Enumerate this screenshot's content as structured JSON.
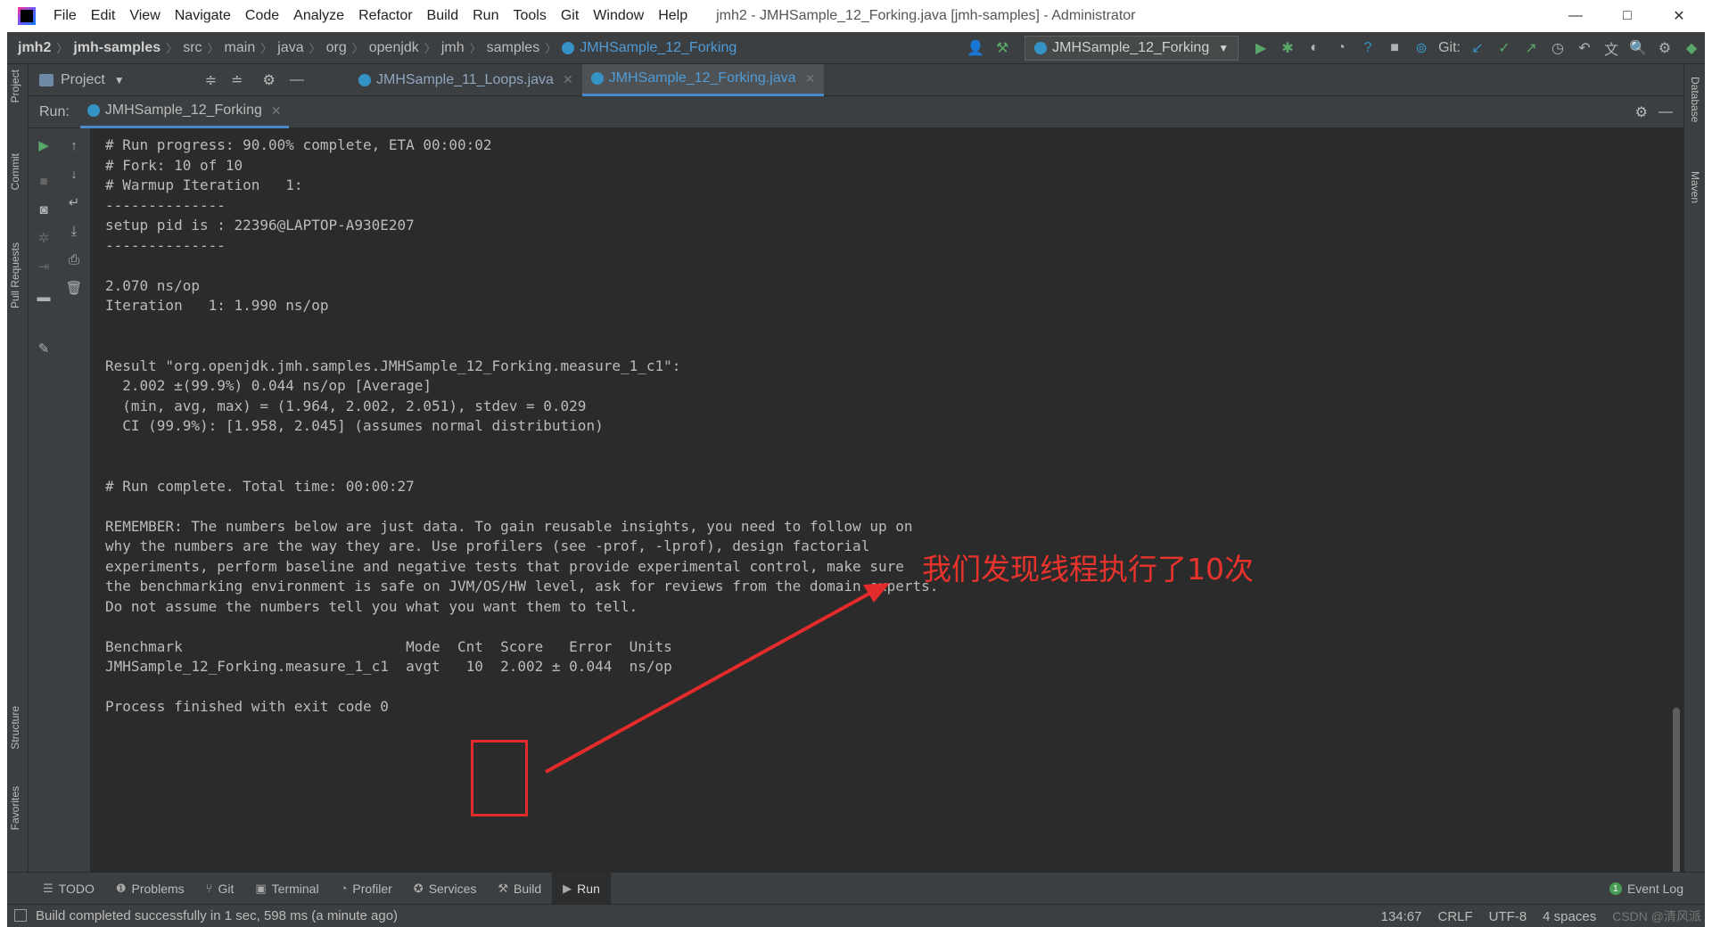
{
  "window": {
    "title": "jmh2 - JMHSample_12_Forking.java [jmh-samples] - Administrator",
    "controls": [
      "—",
      "□",
      "✕"
    ]
  },
  "menu": [
    "File",
    "Edit",
    "View",
    "Navigate",
    "Code",
    "Analyze",
    "Refactor",
    "Build",
    "Run",
    "Tools",
    "Git",
    "Window",
    "Help"
  ],
  "breadcrumbs": [
    "jmh2",
    "jmh-samples",
    "src",
    "main",
    "java",
    "org",
    "openjdk",
    "jmh",
    "samples",
    "JMHSample_12_Forking"
  ],
  "toolbar": {
    "run_config": "JMHSample_12_Forking",
    "git_label": "Git:"
  },
  "editor_tabs": {
    "project_label": "Project",
    "files": [
      "JMHSample_11_Loops.java",
      "JMHSample_12_Forking.java"
    ]
  },
  "side_tabs": {
    "left": [
      "Project",
      "Commit",
      "Pull Requests",
      "Structure",
      "Favorites"
    ],
    "right": [
      "Database",
      "Maven"
    ]
  },
  "run_panel": {
    "label": "Run:",
    "tab": "JMHSample_12_Forking"
  },
  "console": {
    "lines": [
      "# Run progress: 90.00% complete, ETA 00:00:02",
      "# Fork: 10 of 10",
      "# Warmup Iteration   1:",
      "--------------",
      "setup pid is : 22396@LAPTOP-A930E207",
      "--------------",
      "",
      "2.070 ns/op",
      "Iteration   1: 1.990 ns/op",
      "",
      "",
      "Result \"org.openjdk.jmh.samples.JMHSample_12_Forking.measure_1_c1\":",
      "  2.002 ±(99.9%) 0.044 ns/op [Average]",
      "  (min, avg, max) = (1.964, 2.002, 2.051), stdev = 0.029",
      "  CI (99.9%): [1.958, 2.045] (assumes normal distribution)",
      "",
      "",
      "# Run complete. Total time: 00:00:27",
      "",
      "REMEMBER: The numbers below are just data. To gain reusable insights, you need to follow up on",
      "why the numbers are the way they are. Use profilers (see -prof, -lprof), design factorial",
      "experiments, perform baseline and negative tests that provide experimental control, make sure",
      "the benchmarking environment is safe on JVM/OS/HW level, ask for reviews from the domain experts.",
      "Do not assume the numbers tell you what you want them to tell.",
      "",
      "Benchmark                          Mode  Cnt  Score   Error  Units",
      "JMHSample_12_Forking.measure_1_c1  avgt   10  2.002 ± 0.044  ns/op",
      "",
      "Process finished with exit code 0"
    ]
  },
  "annotation": {
    "text": "我们发现线程执行了10次",
    "color": "#e8332c"
  },
  "bottom_tabs": [
    "TODO",
    "Problems",
    "Git",
    "Terminal",
    "Profiler",
    "Services",
    "Build",
    "Run"
  ],
  "event_log": "Event Log",
  "status": {
    "message": "Build completed successfully in 1 sec, 598 ms (a minute ago)",
    "position": "134:67",
    "line_sep": "CRLF",
    "encoding": "UTF-8",
    "indent": "4 spaces",
    "watermark": "CSDN @清风派"
  }
}
